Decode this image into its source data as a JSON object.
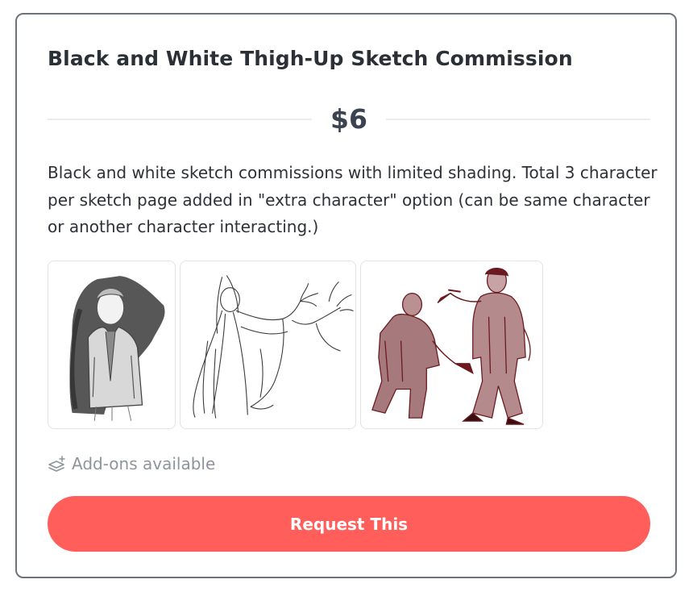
{
  "commission": {
    "title": "Black and White Thigh-Up Sketch Commission",
    "price": "$6",
    "description": "Black and white sketch commissions with limited shading. Total 3 character per sketch page added in \"extra character\" option (can be same character or another character interacting.)",
    "addons_label": "Add-ons available",
    "request_button_label": "Request This"
  },
  "gallery": [
    {
      "subject": "grayscale sketch of a man in a jacket with a dark shadow behind him"
    },
    {
      "subject": "line sketch of a bearded old wizard with arms outstretched"
    },
    {
      "subject": "red-brown sketch of two men fighting, one with a knife"
    }
  ],
  "icons": {
    "addons": "layers-plus-icon"
  },
  "colors": {
    "accent": "#ff5e5b",
    "title_text": "#2b2f36",
    "price_text": "#3c4350",
    "muted_text": "#8f949c",
    "card_border": "#6e737a",
    "sketch_red": "#7a1f24"
  }
}
